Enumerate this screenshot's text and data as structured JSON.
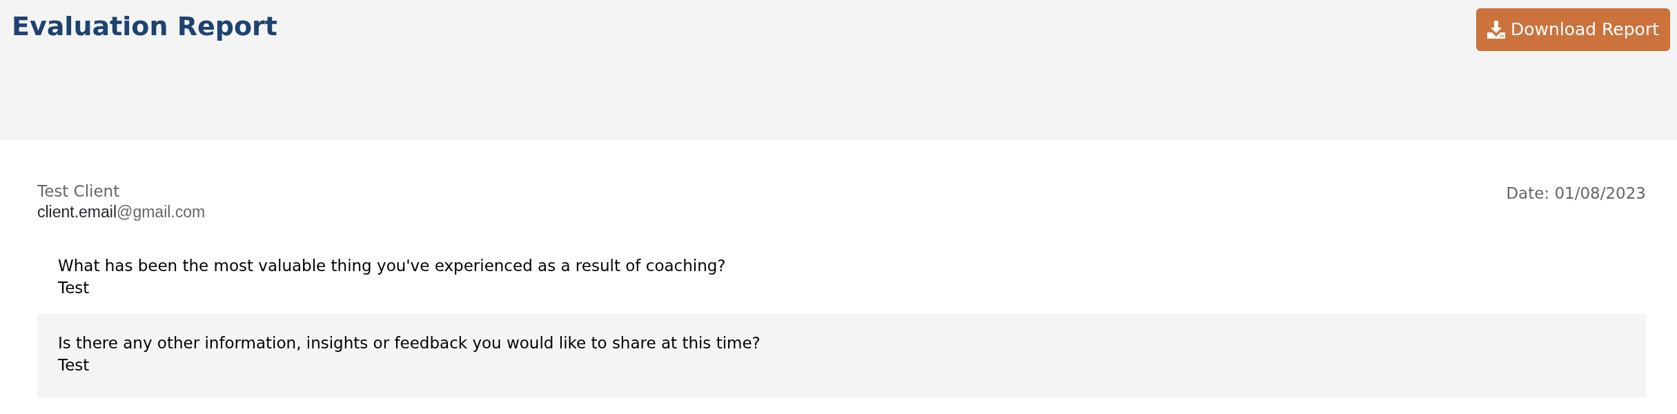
{
  "header": {
    "title": "Evaluation Report",
    "download_button": "Download Report"
  },
  "client": {
    "name": "Test Client",
    "email": {
      "user": "client.email",
      "domain": "@gmail.com"
    },
    "date": "Date: 01/08/2023"
  },
  "answers": [
    {
      "question": "What has been the most valuable thing you've experienced as a result of coaching?",
      "answer": "Test",
      "shaded": false
    },
    {
      "question": "Is there any other information, insights or feedback you would like to share at this time?",
      "answer": "Test",
      "shaded": true
    }
  ]
}
